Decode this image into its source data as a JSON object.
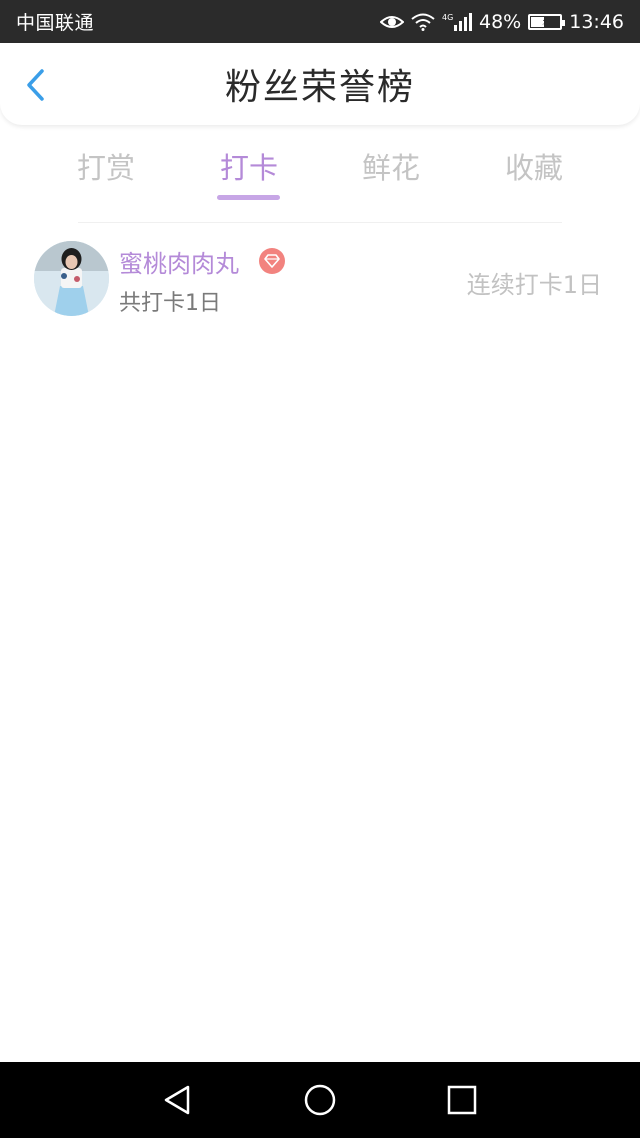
{
  "status_bar": {
    "carrier": "中国联通",
    "network": "4G",
    "battery_percent": "48%",
    "battery_level": 0.48,
    "time": "13:46",
    "icons": [
      "eye-icon",
      "wifi-icon",
      "signal-icon",
      "battery-icon"
    ]
  },
  "header": {
    "title": "粉丝荣誉榜",
    "back_icon": "chevron-left-icon",
    "accent_color": "#3a9ee8"
  },
  "tabs": [
    {
      "label": "打赏",
      "active": false
    },
    {
      "label": "打卡",
      "active": true
    },
    {
      "label": "鲜花",
      "active": false
    },
    {
      "label": "收藏",
      "active": false
    }
  ],
  "colors": {
    "active_tab": "#b48ad8",
    "indicator": "#c7a6e6",
    "inactive_tab": "#c4c4c4",
    "badge": "#f2837f"
  },
  "list": [
    {
      "name": "蜜桃肉肉丸",
      "badge_icon": "diamond-icon",
      "total": "共打卡1日",
      "streak": "连续打卡1日"
    }
  ],
  "nav_bar": {
    "buttons": [
      "back-triangle-icon",
      "home-circle-icon",
      "recents-square-icon"
    ]
  }
}
